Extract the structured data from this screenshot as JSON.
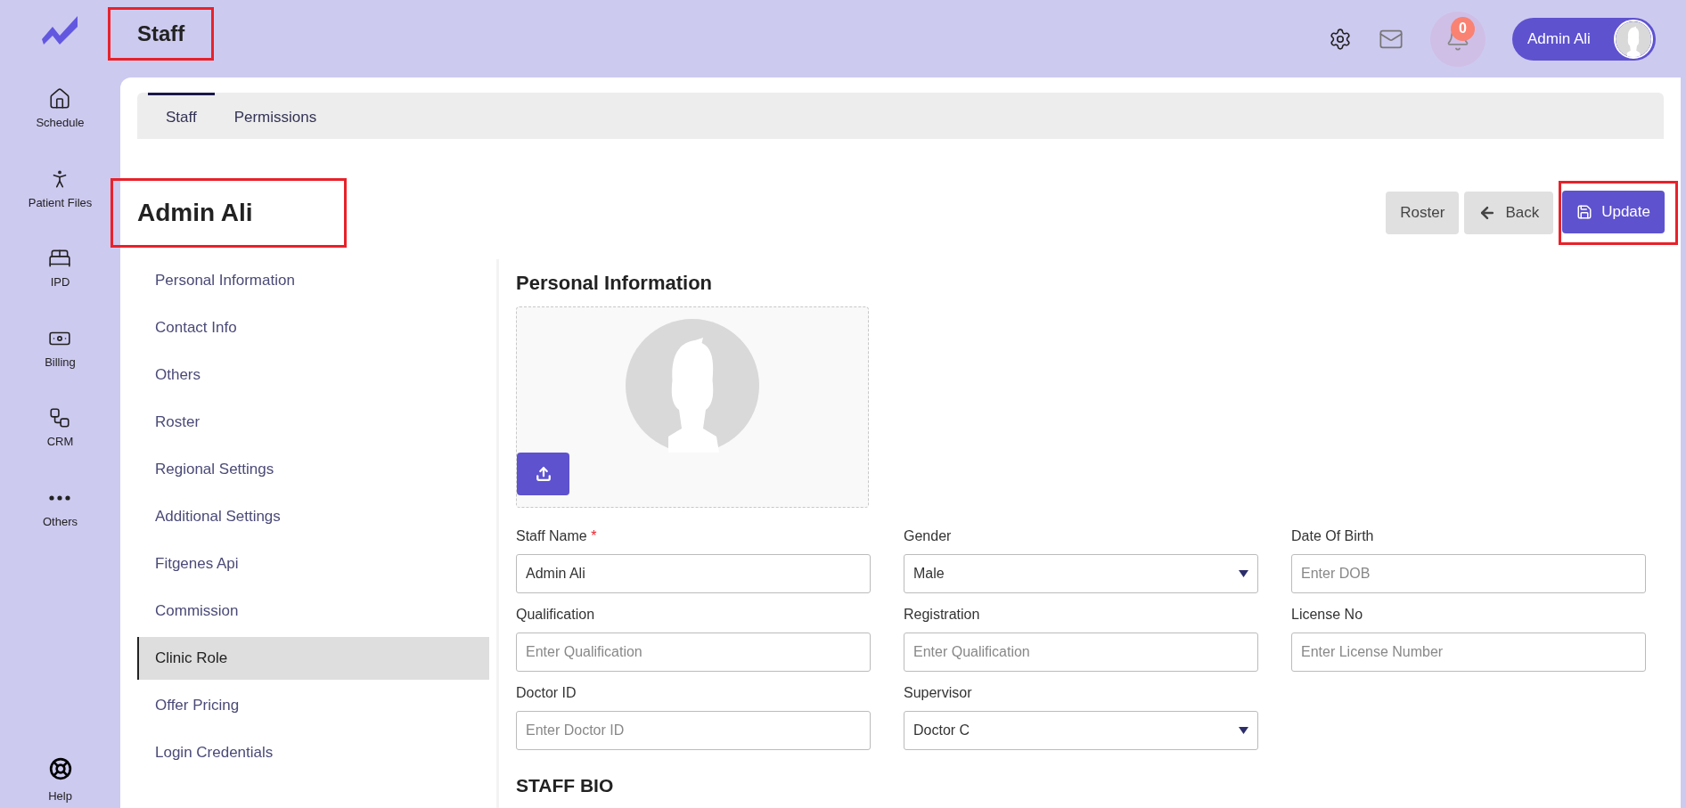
{
  "header": {
    "title": "Staff",
    "highlighted": true,
    "notification_count": "0",
    "user_name": "Admin Ali"
  },
  "sidebar": {
    "items": [
      {
        "label": "Schedule",
        "kind": "home"
      },
      {
        "label": "Patient Files",
        "kind": "person"
      },
      {
        "label": "IPD",
        "kind": "bed"
      },
      {
        "label": "Billing",
        "kind": "money"
      },
      {
        "label": "CRM",
        "kind": "network"
      },
      {
        "label": "Others",
        "kind": "more"
      }
    ],
    "help": "Help"
  },
  "tabs": [
    {
      "label": "Staff",
      "selected": true
    },
    {
      "label": "Permissions",
      "selected": false
    }
  ],
  "staff": {
    "name": "Admin Ali",
    "highlighted": true
  },
  "actions": [
    {
      "label": "Roster",
      "kind": "plain",
      "highlighted": false
    },
    {
      "label": "Back",
      "kind": "back",
      "highlighted": false
    },
    {
      "label": "Update",
      "kind": "primary",
      "highlighted": true
    }
  ],
  "sections": [
    {
      "label": "Personal Information",
      "selected": false
    },
    {
      "label": "Contact Info",
      "selected": false
    },
    {
      "label": "Others",
      "selected": false
    },
    {
      "label": "Roster",
      "selected": false
    },
    {
      "label": "Regional Settings",
      "selected": false
    },
    {
      "label": "Additional Settings",
      "selected": false
    },
    {
      "label": "Fitgenes Api",
      "selected": false
    },
    {
      "label": "Commission",
      "selected": false
    },
    {
      "label": "Clinic Role",
      "selected": true
    },
    {
      "label": "Offer Pricing",
      "selected": false
    },
    {
      "label": "Login Credentials",
      "selected": false
    }
  ],
  "form": {
    "title": "Personal Information",
    "fields": [
      {
        "label": "Staff Name",
        "required": true,
        "kind": "text",
        "value": "Admin Ali"
      },
      {
        "label": "Gender",
        "required": false,
        "kind": "select",
        "value": "Male"
      },
      {
        "label": "Date Of Birth",
        "required": false,
        "kind": "text",
        "placeholder": "Enter DOB"
      },
      {
        "label": "Qualification",
        "required": false,
        "kind": "text",
        "placeholder": "Enter Qualification"
      },
      {
        "label": "Registration",
        "required": false,
        "kind": "text",
        "placeholder": "Enter Qualification"
      },
      {
        "label": "License No",
        "required": false,
        "kind": "text",
        "placeholder": "Enter License Number"
      },
      {
        "label": "Doctor ID",
        "required": false,
        "kind": "text",
        "placeholder": "Enter Doctor ID"
      },
      {
        "label": "Supervisor",
        "required": false,
        "kind": "select",
        "value": "Doctor C"
      }
    ],
    "required_mark": "*",
    "bio_title": "STAFF BIO"
  }
}
